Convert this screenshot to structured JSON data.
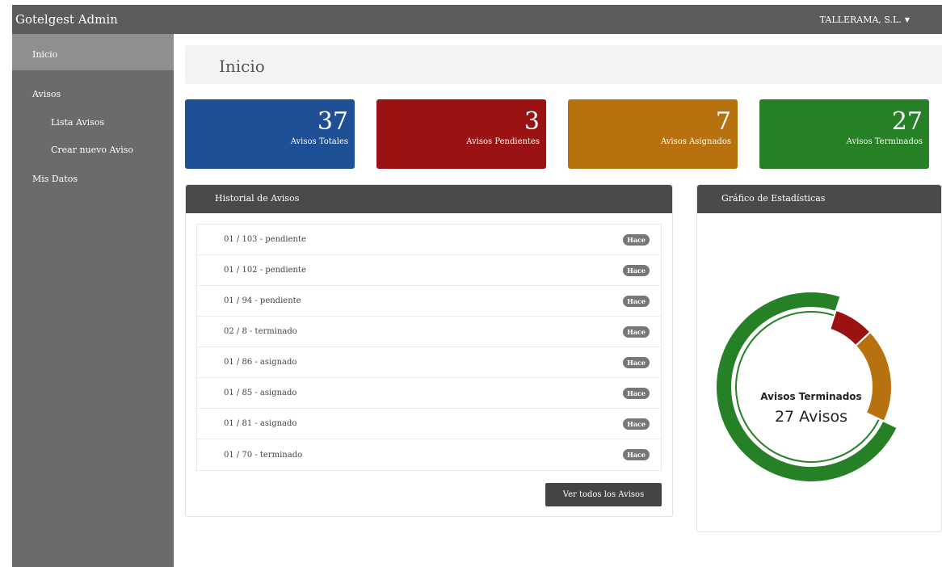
{
  "app": {
    "title": "Gotelgest Admin",
    "user": "TALLERAMA, S.L."
  },
  "sidebar": {
    "items": [
      {
        "label": "Inicio"
      },
      {
        "label": "Avisos"
      },
      {
        "label": "Lista Avisos"
      },
      {
        "label": "Crear nuevo Aviso"
      },
      {
        "label": "Mis Datos"
      }
    ]
  },
  "page": {
    "title": "Inicio"
  },
  "stats": [
    {
      "value": "37",
      "label": "Avisos Totales",
      "color": "#1f4f95"
    },
    {
      "value": "3",
      "label": "Avisos Pendientes",
      "color": "#9a1212"
    },
    {
      "value": "7",
      "label": "Avisos Asignados",
      "color": "#b7720f"
    },
    {
      "value": "27",
      "label": "Avisos Terminados",
      "color": "#268026"
    }
  ],
  "history": {
    "title": "Historial de Avisos",
    "items": [
      {
        "text": "01 / 103 - pendiente",
        "badge": "Hace"
      },
      {
        "text": "01 / 102 - pendiente",
        "badge": "Hace"
      },
      {
        "text": "01 / 94 - pendiente",
        "badge": "Hace"
      },
      {
        "text": "02 / 8 - terminado",
        "badge": "Hace"
      },
      {
        "text": "01 / 86 - asignado",
        "badge": "Hace"
      },
      {
        "text": "01 / 85 - asignado",
        "badge": "Hace"
      },
      {
        "text": "01 / 81 - asignado",
        "badge": "Hace"
      },
      {
        "text": "01 / 70 - terminado",
        "badge": "Hace"
      }
    ],
    "button": "Ver todos los Avisos"
  },
  "stats_chart": {
    "title": "Gráfico de Estadísticas",
    "center_title": "Avisos Terminados",
    "center_value": "27 Avisos"
  },
  "chart_data": {
    "type": "pie",
    "segments": [
      {
        "name": "Avisos Terminados",
        "value": 27,
        "color": "#268026"
      },
      {
        "name": "Avisos Asignados",
        "value": 7,
        "color": "#b7720f"
      },
      {
        "name": "Avisos Pendientes",
        "value": 3,
        "color": "#9a1212"
      }
    ],
    "highlight": "Avisos Terminados"
  }
}
